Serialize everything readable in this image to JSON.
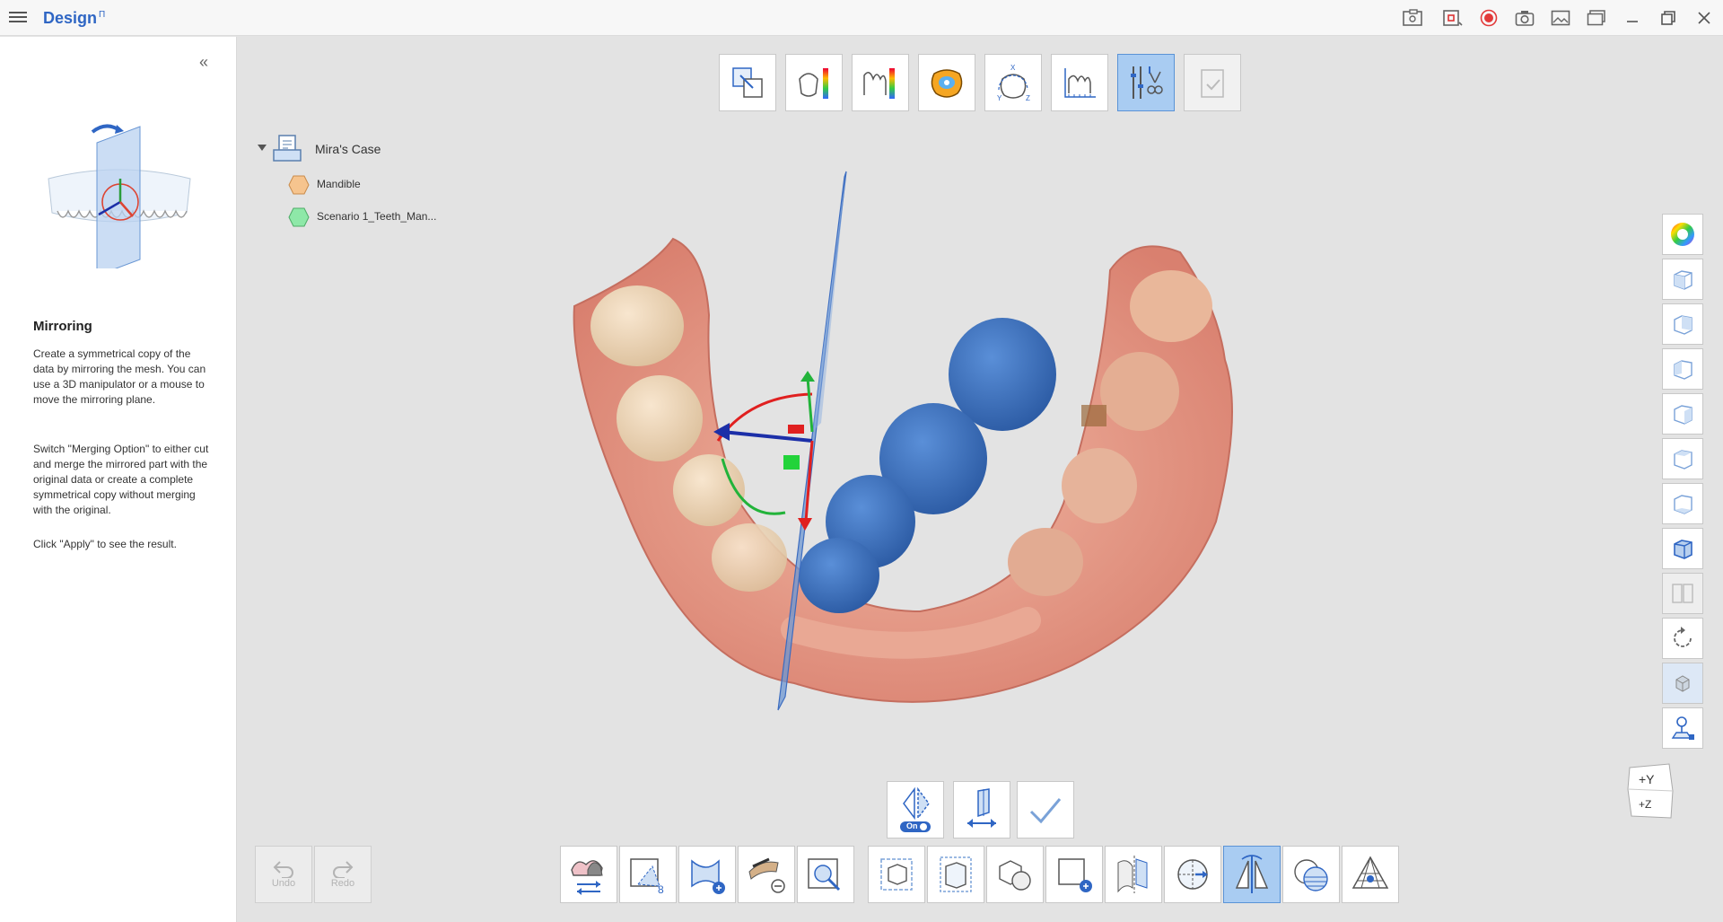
{
  "app": {
    "title": "Design",
    "title_mark": "Π"
  },
  "titlebar": {
    "icons": [
      "snapshot-compare-icon",
      "screen-record-region-icon",
      "record-icon",
      "camera-icon",
      "image-icon",
      "gallery-icon",
      "minimize-icon",
      "restore-icon",
      "close-icon"
    ]
  },
  "sidebar": {
    "heading": "Mirroring",
    "paragraphs": [
      "Create a symmetrical copy of the data by mirroring the mesh. You can use a 3D manipulator or a mouse to move the mirroring plane.",
      "Switch \"Merging Option\" to either cut and merge the mirrored part with the original data or create a complete symmetrical copy without merging with the original.",
      "Click \"Apply\" to see the result."
    ]
  },
  "case_tree": {
    "case_name": "Mira's Case",
    "items": [
      {
        "label": "Mandible",
        "color": "#f6c48e"
      },
      {
        "label": "Scenario 1_Teeth_Man...",
        "color": "#8ee8a8"
      }
    ]
  },
  "top_toolbar": {
    "active_index": 6,
    "tools": [
      "align-icon",
      "deviation-map-icon",
      "cross-section-map-icon",
      "occlusion-map-icon",
      "axis-orient-icon",
      "measure-icon",
      "mirror-tools-icon",
      "apply-check-icon"
    ]
  },
  "mirror_panel": {
    "merge_toggle_label": "On"
  },
  "history": {
    "undo": "Undo",
    "redo": "Redo"
  },
  "orientation_cube": {
    "y": "+Y",
    "z": "+Z"
  },
  "colors": {
    "accent": "#2f66c4",
    "active_tool": "#a9ccf2",
    "crown_blue": "#3d73c2"
  }
}
